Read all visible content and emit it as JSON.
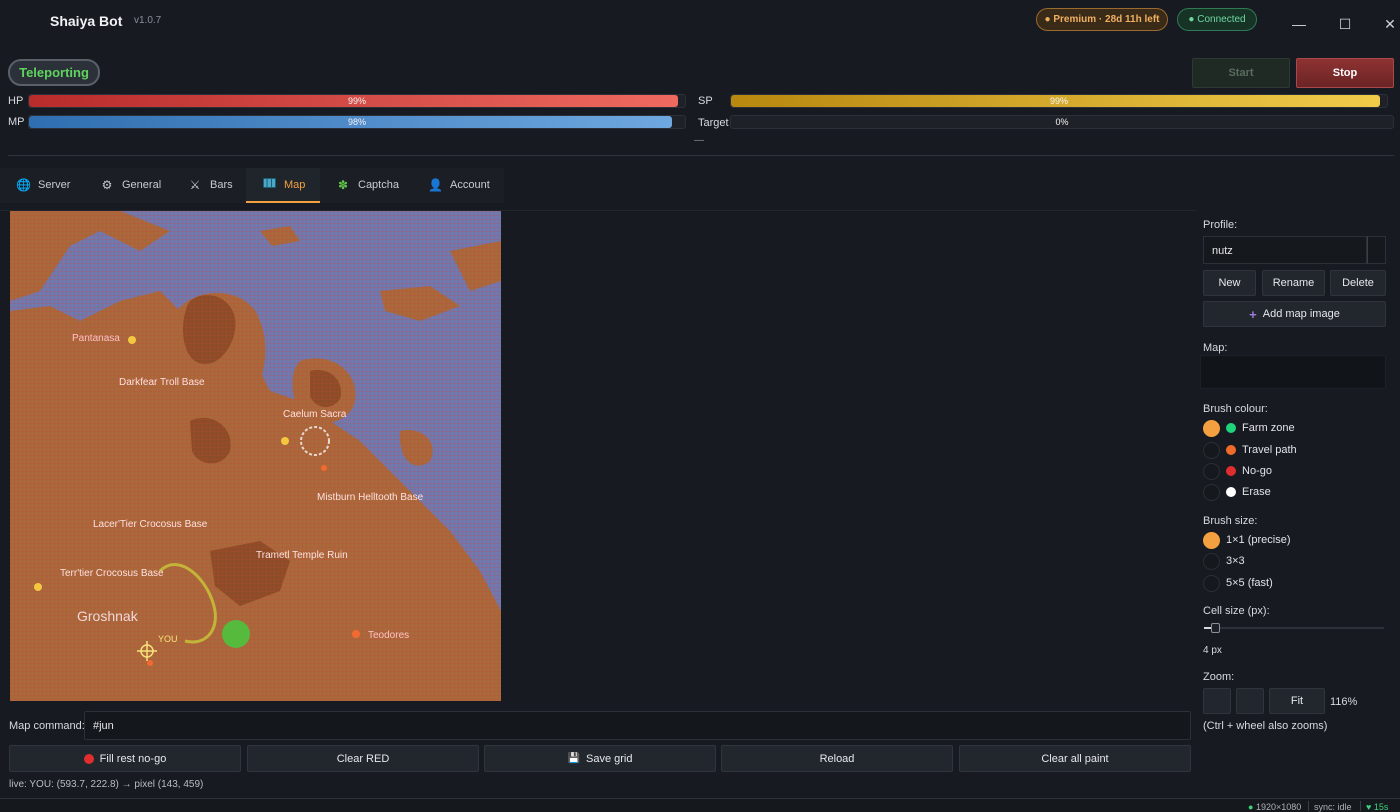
{
  "app": {
    "title": "Shaiya Bot",
    "version": "v1.0.7"
  },
  "header": {
    "premium": "● Premium · 28d 11h left",
    "connected": "● Connected"
  },
  "window": {
    "minimize": "—",
    "maximize": "☐",
    "close": "✕"
  },
  "status": {
    "state": "Teleporting"
  },
  "controls": {
    "start": "Start",
    "stop": "Stop"
  },
  "bars": {
    "hp": {
      "label": "HP",
      "text": "99%",
      "value": 0.99
    },
    "sp": {
      "label": "SP",
      "text": "99%",
      "value": 0.99
    },
    "mp": {
      "label": "MP",
      "text": "98%",
      "value": 0.98
    },
    "target": {
      "label": "Target",
      "text": "0%",
      "value": 0
    }
  },
  "misc": {
    "dash": "—"
  },
  "tabs": [
    {
      "label": "Server",
      "icon": "globe-icon"
    },
    {
      "label": "General",
      "icon": "gear-icon"
    },
    {
      "label": "Bars",
      "icon": "crossed-swords-icon"
    },
    {
      "label": "Map",
      "icon": "map-icon",
      "active": true
    },
    {
      "label": "Captcha",
      "icon": "puzzle-icon"
    },
    {
      "label": "Account",
      "icon": "user-icon"
    }
  ],
  "map": {
    "places": {
      "pantanasa": "Pantanasa",
      "darkfear": "Darkfear Troll Base",
      "caelum": "Caelum Sacra",
      "mistburn": "Mistburn Helltooth Base",
      "lacerttier": "Lacer'Tier Crocosus Base",
      "trametl": "Trametl Temple Ruin",
      "terrtier": "Terr'tier Crocosus Base",
      "groshnak": "Groshnak",
      "teodores": "Teodores",
      "you": "YOU"
    }
  },
  "command": {
    "label": "Map command:",
    "value": "#jun"
  },
  "actions": {
    "fill_rest": "Fill rest no-go",
    "clear_red": "Clear RED",
    "save_grid": "Save grid",
    "reload": "Reload",
    "clear_all": "Clear all paint"
  },
  "live": "live: YOU: (593.7, 222.8) → pixel (143, 459)",
  "statusbar": {
    "resolution": "1920×1080",
    "sync": "sync: idle",
    "timer": "♥ 15s"
  },
  "sidebar": {
    "profile_label": "Profile:",
    "profile_value": "nutz",
    "new": "New",
    "rename": "Rename",
    "delete": "Delete",
    "add_map": "Add map image",
    "map_label": "Map:",
    "brush_colour_label": "Brush colour:",
    "colours": [
      {
        "label": "Farm zone",
        "color": "#1ed37a",
        "selected": true
      },
      {
        "label": "Travel path",
        "color": "#f26a2a"
      },
      {
        "label": "No-go",
        "color": "#e02d2d"
      },
      {
        "label": "Erase",
        "color": "#ffffff"
      }
    ],
    "brush_size_label": "Brush size:",
    "sizes": [
      {
        "label": "1×1 (precise)",
        "selected": true
      },
      {
        "label": "3×3"
      },
      {
        "label": "5×5 (fast)"
      }
    ],
    "cell_size_label": "Cell size (px):",
    "cell_size_value": "4 px",
    "cell_size_fraction": 0.04,
    "zoom_label": "Zoom:",
    "fit": "Fit",
    "zoom_value": "116%",
    "zoom_hint": "(Ctrl + wheel also zooms)"
  }
}
